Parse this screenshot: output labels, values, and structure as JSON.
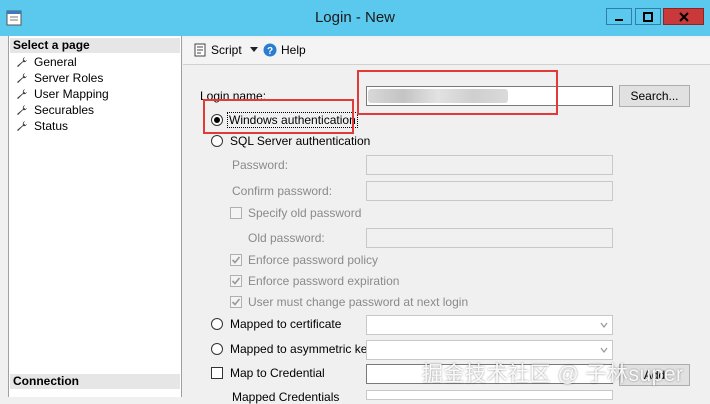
{
  "window": {
    "title": "Login - New"
  },
  "left_pane": {
    "select_page_header": "Select a page",
    "pages": [
      "General",
      "Server Roles",
      "User Mapping",
      "Securables",
      "Status"
    ],
    "connection_header": "Connection"
  },
  "toolbar": {
    "script_label": "Script",
    "help_label": "Help"
  },
  "form": {
    "login_name_label": "Login name:",
    "login_name_value": "",
    "search_button": "Search...",
    "windows_auth_label": "Windows authentication",
    "sql_auth_label": "SQL Server authentication",
    "password_label": "Password:",
    "confirm_password_label": "Confirm password:",
    "specify_old_password_label": "Specify old password",
    "old_password_label": "Old password:",
    "enforce_policy_label": "Enforce password policy",
    "enforce_expiration_label": "Enforce password expiration",
    "must_change_label": "User must change password at next login",
    "mapped_certificate_label": "Mapped to certificate",
    "mapped_asymmetric_label": "Mapped to asymmetric key",
    "map_credential_label": "Map to Credential",
    "mapped_credentials_label": "Mapped Credentials",
    "add_button": "Add"
  },
  "watermark": "掘金技术社区 @ 子林super",
  "colors": {
    "titlebar": "#5bc9ee",
    "highlight_box": "#e03a3a",
    "close_button": "#c9393a"
  }
}
